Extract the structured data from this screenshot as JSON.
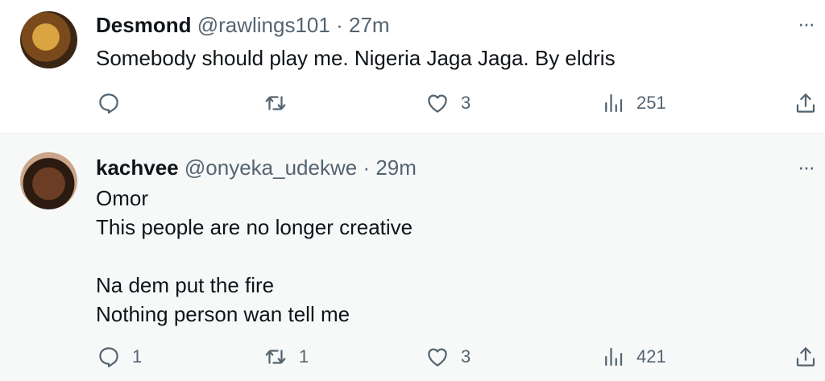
{
  "tweets": [
    {
      "name": "Desmond",
      "handle": "@rawlings101",
      "separator": "·",
      "time": "27m",
      "more_glyph": "···",
      "lines": [
        "Somebody should play me. Nigeria Jaga Jaga. By eldris"
      ],
      "replies": "",
      "retweets": "",
      "likes": "3",
      "views": "251",
      "icons": [
        "reply-icon",
        "retweet-icon",
        "like-icon",
        "views-icon",
        "share-icon"
      ]
    },
    {
      "name": "kachvee",
      "handle": "@onyeka_udekwe",
      "separator": "·",
      "time": "29m",
      "more_glyph": "···",
      "lines": [
        "Omor",
        "This people are no longer creative",
        "",
        "Na dem put the fire",
        "Nothing person wan tell me"
      ],
      "replies": "1",
      "retweets": "1",
      "likes": "3",
      "views": "421",
      "icons": [
        "reply-icon",
        "retweet-icon",
        "like-icon",
        "views-icon",
        "share-icon"
      ]
    }
  ],
  "colors": {
    "text_primary": "#0f1419",
    "text_secondary": "#536471",
    "hover_background": "#f7f9f9",
    "divider": "#eff3f4"
  }
}
